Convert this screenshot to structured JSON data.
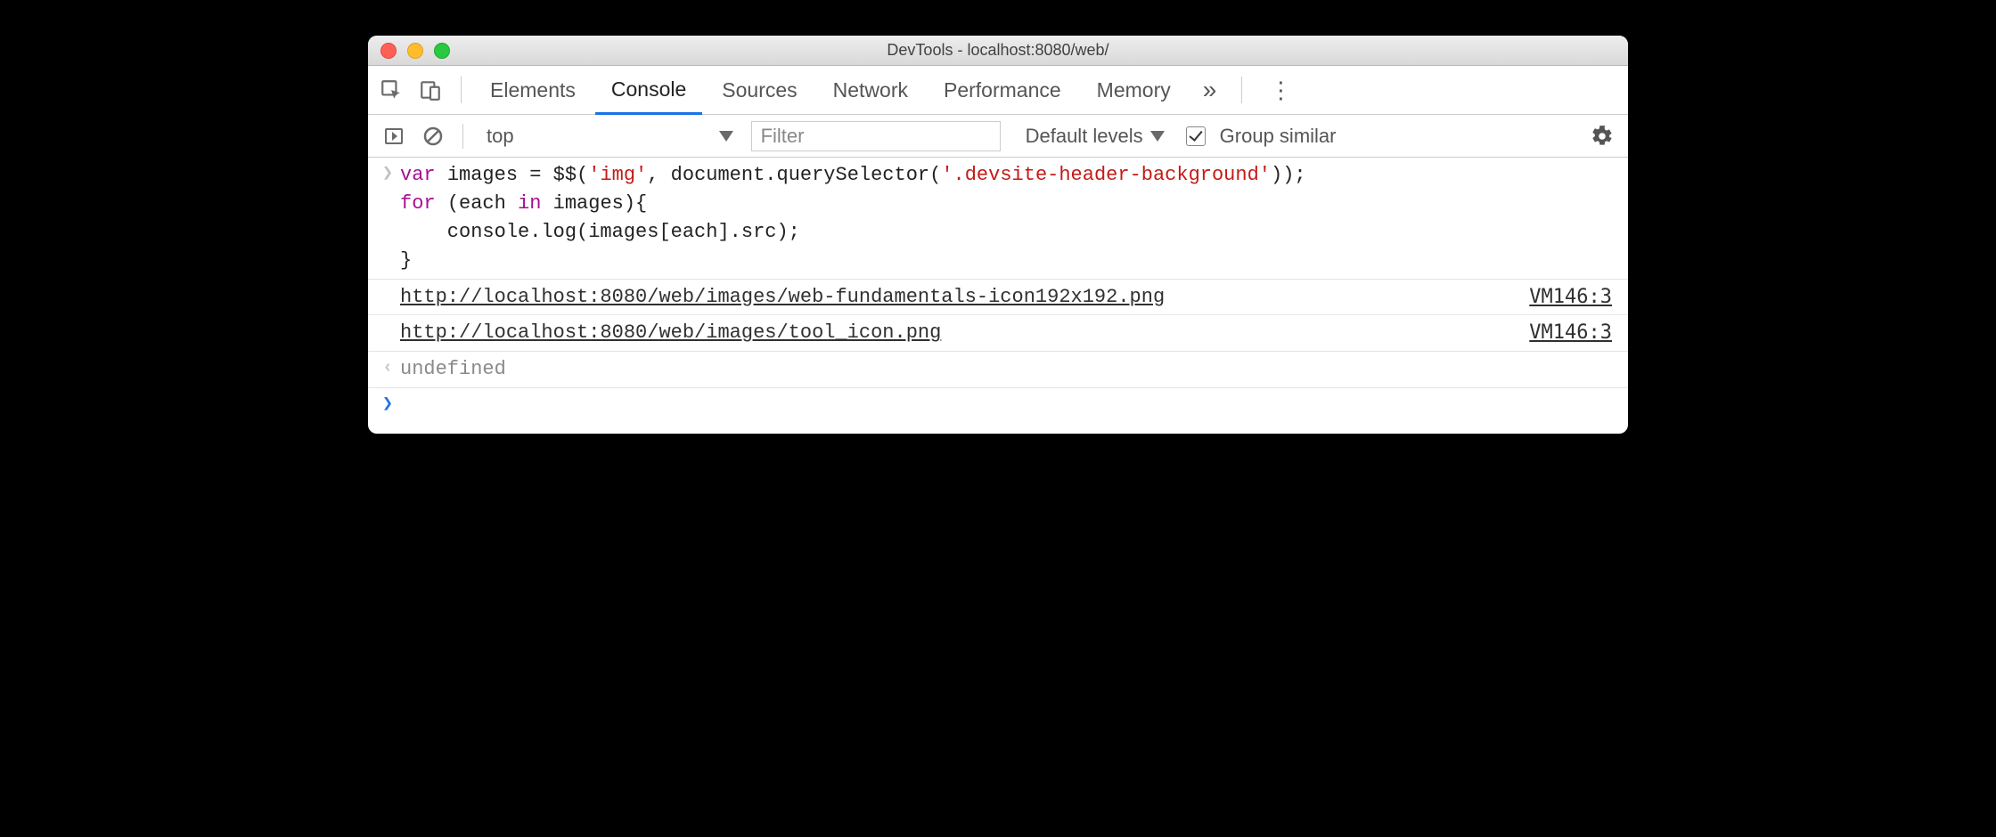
{
  "window": {
    "title": "DevTools - localhost:8080/web/"
  },
  "tabs": {
    "items": [
      "Elements",
      "Console",
      "Sources",
      "Network",
      "Performance",
      "Memory"
    ],
    "active_index": 1,
    "overflow_glyph": "»"
  },
  "toolbar": {
    "context": "top",
    "filter_placeholder": "Filter",
    "levels_label": "Default levels",
    "group_similar_label": "Group similar",
    "group_similar_checked": true
  },
  "console": {
    "input_code_lines": [
      {
        "segments": [
          {
            "t": "var ",
            "c": "kw"
          },
          {
            "t": "images",
            "c": "plain"
          },
          {
            "t": " = $$(",
            "c": "op"
          },
          {
            "t": "'img'",
            "c": "str"
          },
          {
            "t": ", document.querySelector(",
            "c": "op"
          },
          {
            "t": "'.devsite-header-background'",
            "c": "str"
          },
          {
            "t": "));",
            "c": "op"
          }
        ]
      },
      {
        "segments": [
          {
            "t": "for ",
            "c": "kw"
          },
          {
            "t": "(each ",
            "c": "plain"
          },
          {
            "t": "in ",
            "c": "kw"
          },
          {
            "t": "images){",
            "c": "plain"
          }
        ]
      },
      {
        "segments": [
          {
            "t": "    console.log(images[each].src);",
            "c": "plain"
          }
        ]
      },
      {
        "segments": [
          {
            "t": "}",
            "c": "plain"
          }
        ]
      }
    ],
    "logs": [
      {
        "url": "http://localhost:8080/web/images/web-fundamentals-icon192x192.png",
        "source": "VM146:3"
      },
      {
        "url": "http://localhost:8080/web/images/tool_icon.png",
        "source": "VM146:3"
      }
    ],
    "return_value": "undefined"
  }
}
